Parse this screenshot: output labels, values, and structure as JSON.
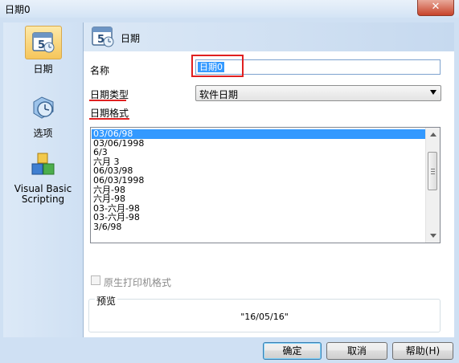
{
  "window": {
    "title": "日期0",
    "close_glyph": "✕"
  },
  "sidebar": {
    "items": [
      {
        "label": "日期",
        "icon": "calendar-icon",
        "active": true
      },
      {
        "label": "选项",
        "icon": "options-clock-icon",
        "active": false
      },
      {
        "label": "Visual Basic Scripting",
        "icon": "vbscript-cubes-icon",
        "active": false
      }
    ]
  },
  "header": {
    "title": "日期",
    "icon_day": "5"
  },
  "form": {
    "name_label": "名称",
    "name_value": "日期0",
    "date_type_label": "日期类型",
    "date_type_value": "软件日期",
    "date_format_label": "日期格式"
  },
  "formats": [
    "03/06/98",
    "03/06/1998",
    "6/3",
    "六月 3",
    "06/03/98",
    "06/03/1998",
    "六月-98",
    "六月-98",
    "03-六月-98",
    "03-六月-98",
    "3/6/98"
  ],
  "selected_format_index": 0,
  "native_print_label": "原生打印机格式",
  "preview": {
    "label": "预览",
    "value": "\"16/05/16\""
  },
  "buttons": {
    "ok": "确定",
    "cancel": "取消",
    "help": "帮助(H)"
  },
  "colors": {
    "accent": "#3399ff",
    "annotation_red": "#e02020",
    "frame": "#cfe0f3"
  }
}
